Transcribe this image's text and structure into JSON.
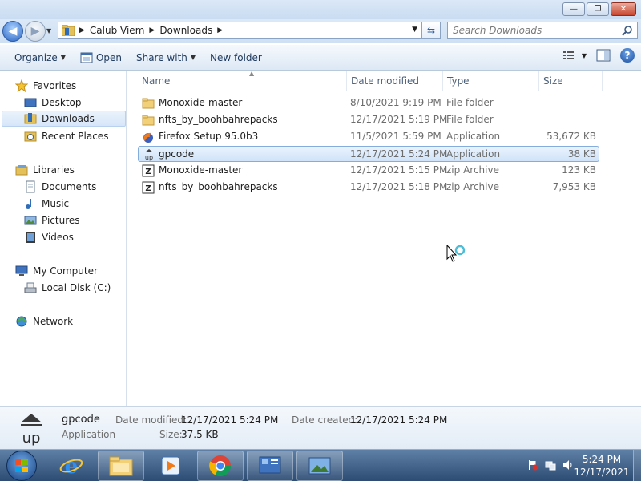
{
  "window": {
    "controls": {
      "minimize": "—",
      "maximize": "❐",
      "close": "✕"
    }
  },
  "address": {
    "crumbs": [
      "Calub Viem",
      "Downloads"
    ],
    "search_placeholder": "Search Downloads"
  },
  "toolbar": {
    "organize": "Organize",
    "open": "Open",
    "share_with": "Share with",
    "new_folder": "New folder"
  },
  "nav": {
    "favorites": "Favorites",
    "desktop": "Desktop",
    "downloads": "Downloads",
    "recent_places": "Recent Places",
    "libraries": "Libraries",
    "documents": "Documents",
    "music": "Music",
    "pictures": "Pictures",
    "videos": "Videos",
    "my_computer": "My Computer",
    "local_disk": "Local Disk (C:)",
    "network": "Network"
  },
  "columns": {
    "name": "Name",
    "date_modified": "Date modified",
    "type": "Type",
    "size": "Size"
  },
  "files": [
    {
      "name": "Monoxide-master",
      "date": "8/10/2021 9:19 PM",
      "type": "File folder",
      "size": "",
      "icon": "folder-icon"
    },
    {
      "name": "nfts_by_boohbahrepacks",
      "date": "12/17/2021 5:19 PM",
      "type": "File folder",
      "size": "",
      "icon": "folder-icon"
    },
    {
      "name": "Firefox Setup 95.0b3",
      "date": "11/5/2021 5:59 PM",
      "type": "Application",
      "size": "53,672 KB",
      "icon": "firefox-icon"
    },
    {
      "name": "gpcode",
      "date": "12/17/2021 5:24 PM",
      "type": "Application",
      "size": "38 KB",
      "icon": "upx-app-icon"
    },
    {
      "name": "Monoxide-master",
      "date": "12/17/2021 5:15 PM",
      "type": "zip Archive",
      "size": "123 KB",
      "icon": "zip-archive-icon"
    },
    {
      "name": "nfts_by_boohbahrepacks",
      "date": "12/17/2021 5:18 PM",
      "type": "zip Archive",
      "size": "7,953 KB",
      "icon": "zip-archive-icon"
    }
  ],
  "details": {
    "name": "gpcode",
    "type": "Application",
    "date_modified_label": "Date modified:",
    "date_modified": "12/17/2021 5:24 PM",
    "date_created_label": "Date created:",
    "date_created": "12/17/2021 5:24 PM",
    "size_label": "Size:",
    "size": "37.5 KB"
  },
  "taskbar": {
    "time": "5:24 PM",
    "date": "12/17/2021"
  }
}
